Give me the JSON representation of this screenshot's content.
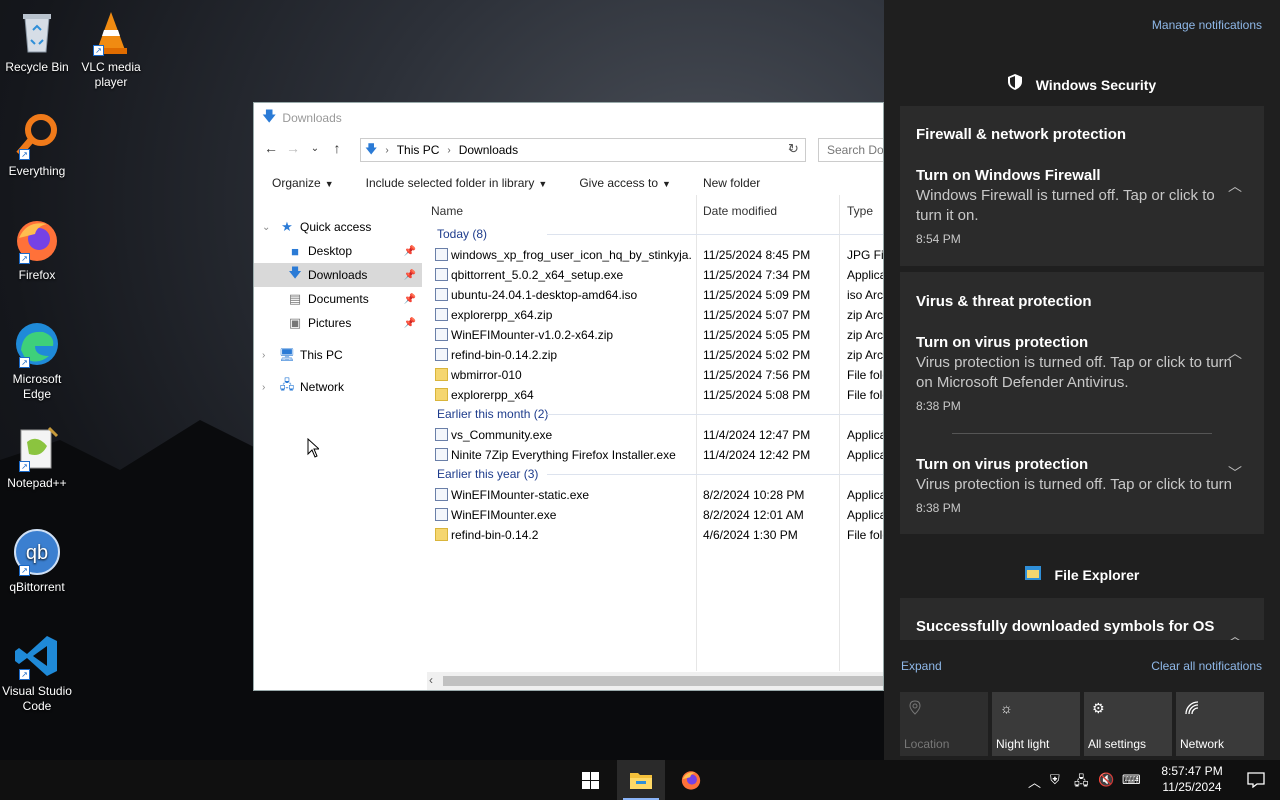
{
  "desktop": {
    "icons": [
      {
        "label": "Recycle Bin",
        "icon": "recycle-bin-icon"
      },
      {
        "label": "VLC media player",
        "icon": "vlc-icon"
      },
      {
        "label": "Everything",
        "icon": "everything-icon"
      },
      {
        "label": "Firefox",
        "icon": "firefox-icon"
      },
      {
        "label": "Microsoft Edge",
        "icon": "edge-icon"
      },
      {
        "label": "Notepad++",
        "icon": "notepadpp-icon"
      },
      {
        "label": "qBittorrent",
        "icon": "qbittorrent-icon"
      },
      {
        "label": "Visual Studio Code",
        "icon": "vscode-icon"
      }
    ]
  },
  "explorer": {
    "title": "Downloads",
    "address": {
      "root": "This PC",
      "current": "Downloads"
    },
    "search_placeholder": "Search Downloads",
    "commands": [
      "Organize",
      "Include selected folder in library",
      "Give access to",
      "New folder"
    ],
    "nav": {
      "quick_access": "Quick access",
      "desktop": "Desktop",
      "downloads": "Downloads",
      "documents": "Documents",
      "pictures": "Pictures",
      "this_pc": "This PC",
      "network": "Network"
    },
    "columns": {
      "name": "Name",
      "date": "Date modified",
      "type": "Type"
    },
    "groups": [
      {
        "label": "Today (8)",
        "files": [
          {
            "name": "windows_xp_frog_user_icon_hq_by_stinkyja...",
            "date": "11/25/2024 8:45 PM",
            "type": "JPG File"
          },
          {
            "name": "qbittorrent_5.0.2_x64_setup.exe",
            "date": "11/25/2024 7:34 PM",
            "type": "Application"
          },
          {
            "name": "ubuntu-24.04.1-desktop-amd64.iso",
            "date": "11/25/2024 5:09 PM",
            "type": "iso Archive"
          },
          {
            "name": "explorerpp_x64.zip",
            "date": "11/25/2024 5:07 PM",
            "type": "zip Archive"
          },
          {
            "name": "WinEFIMounter-v1.0.2-x64.zip",
            "date": "11/25/2024 5:05 PM",
            "type": "zip Archive"
          },
          {
            "name": "refind-bin-0.14.2.zip",
            "date": "11/25/2024 5:02 PM",
            "type": "zip Archive"
          },
          {
            "name": "wbmirror-010",
            "date": "11/25/2024 7:56 PM",
            "type": "File folder"
          },
          {
            "name": "explorerpp_x64",
            "date": "11/25/2024 5:08 PM",
            "type": "File folder"
          }
        ]
      },
      {
        "label": "Earlier this month (2)",
        "files": [
          {
            "name": "vs_Community.exe",
            "date": "11/4/2024 12:47 PM",
            "type": "Application"
          },
          {
            "name": "Ninite 7Zip Everything Firefox Installer.exe",
            "date": "11/4/2024 12:42 PM",
            "type": "Application"
          }
        ]
      },
      {
        "label": "Earlier this year (3)",
        "files": [
          {
            "name": "WinEFIMounter-static.exe",
            "date": "8/2/2024 10:28 PM",
            "type": "Application"
          },
          {
            "name": "WinEFIMounter.exe",
            "date": "8/2/2024 12:01 AM",
            "type": "Application"
          },
          {
            "name": "refind-bin-0.14.2",
            "date": "4/6/2024 1:30 PM",
            "type": "File folder"
          }
        ]
      }
    ]
  },
  "action_center": {
    "manage": "Manage notifications",
    "security_app": "Windows Security",
    "firewall_card": {
      "title": "Firewall & network protection",
      "notif_title": "Turn on Windows Firewall",
      "notif_body": "Windows Firewall is turned off. Tap or click to turn it on.",
      "time": "8:54 PM"
    },
    "virus_card": {
      "title": "Virus & threat protection",
      "n1_title": "Turn on virus protection",
      "n1_body": "Virus protection is turned off. Tap or click to turn on Microsoft Defender Antivirus.",
      "n1_time": "8:38 PM",
      "n2_title": "Turn on virus protection",
      "n2_body": "Virus protection is turned off. Tap or click to turn on Microsoft Defender Antivirus.",
      "n2_time": "8:38 PM"
    },
    "explorer_app": "File Explorer",
    "explorer_notif": "Successfully downloaded symbols for OS",
    "expand": "Expand",
    "clear": "Clear all notifications",
    "quick_actions": [
      {
        "label": "Location",
        "icon": "location-icon",
        "enabled": false
      },
      {
        "label": "Night light",
        "icon": "brightness-icon",
        "enabled": true
      },
      {
        "label": "All settings",
        "icon": "gear-icon",
        "enabled": true
      },
      {
        "label": "Network",
        "icon": "network-icon",
        "enabled": true
      }
    ]
  },
  "taskbar": {
    "time": "8:57:47 PM",
    "date": "11/25/2024"
  }
}
